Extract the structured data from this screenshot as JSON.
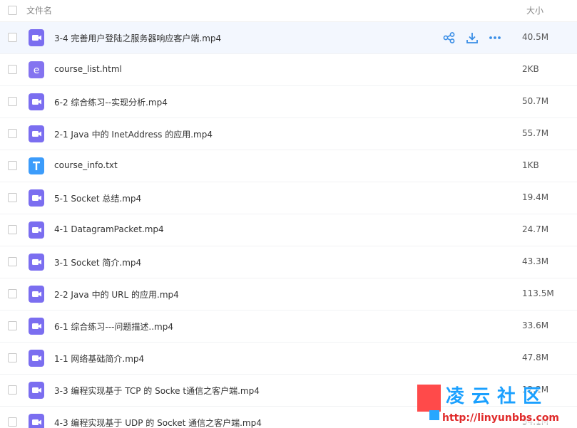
{
  "header": {
    "name_label": "文件名",
    "size_label": "大小"
  },
  "files": [
    {
      "name": "3-4 完善用户登陆之服务器响应客户端.mp4",
      "size": "40.5M",
      "type": "video"
    },
    {
      "name": "course_list.html",
      "size": "2KB",
      "type": "html"
    },
    {
      "name": "6-2 综合练习--实现分析.mp4",
      "size": "50.7M",
      "type": "video"
    },
    {
      "name": "2-1 Java 中的 InetAddress 的应用.mp4",
      "size": "55.7M",
      "type": "video"
    },
    {
      "name": "course_info.txt",
      "size": "1KB",
      "type": "txt"
    },
    {
      "name": "5-1 Socket 总结.mp4",
      "size": "19.4M",
      "type": "video"
    },
    {
      "name": "4-1 DatagramPacket.mp4",
      "size": "24.7M",
      "type": "video"
    },
    {
      "name": "3-1 Socket 简介.mp4",
      "size": "43.3M",
      "type": "video"
    },
    {
      "name": "2-2 Java 中的 URL 的应用.mp4",
      "size": "113.5M",
      "type": "video"
    },
    {
      "name": "6-1 综合练习---问题描述..mp4",
      "size": "33.6M",
      "type": "video"
    },
    {
      "name": "1-1 网络基础简介.mp4",
      "size": "47.8M",
      "type": "video"
    },
    {
      "name": "3-3 编程实现基于 TCP 的 Socke t通信之客户端.mp4",
      "size": "12.2M",
      "type": "video"
    },
    {
      "name": "4-3 编程实现基于 UDP 的 Socket 通信之客户端.mp4",
      "size": "34.1M",
      "type": "video"
    }
  ],
  "row_actions": [
    "share-icon",
    "download-icon",
    "more-icon"
  ],
  "watermark": {
    "brand": "凌云社区",
    "url": "http://linyunbbs.com"
  },
  "colors": {
    "video_icon": "#7b6ef0",
    "txt_icon": "#3c9cfb",
    "action": "#3a8ee6",
    "hover_row": "#f3f7fe"
  }
}
